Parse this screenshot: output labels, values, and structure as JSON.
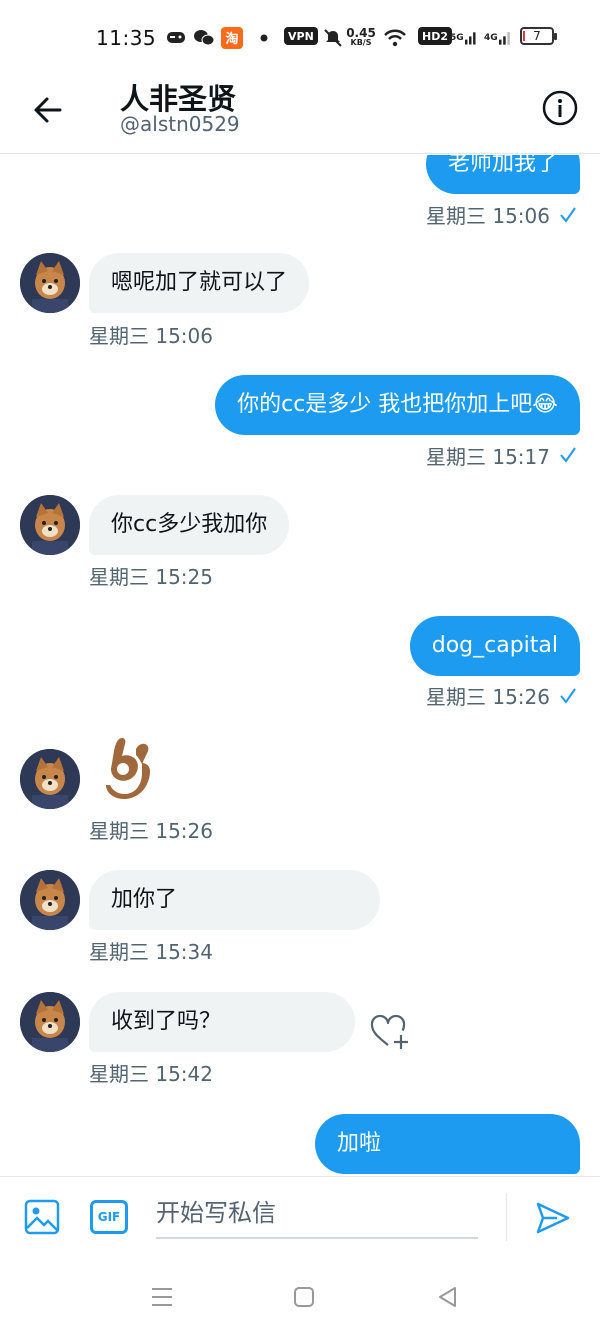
{
  "status_bar": {
    "time": "11:35",
    "speed_value": "0.45",
    "speed_unit": "KB/S",
    "vpn": "VPN",
    "hd": "HD2",
    "sig1": "5G",
    "sig2": "4G",
    "battery": "7"
  },
  "header": {
    "title": "人非圣贤",
    "handle": "@alstn0529"
  },
  "messages": [
    {
      "dir": "out",
      "text": "老师加我了",
      "time": "星期三 15:06"
    },
    {
      "dir": "in",
      "text": "嗯呢加了就可以了",
      "time": "星期三 15:06"
    },
    {
      "dir": "out",
      "text": "你的cc是多少 我也把你加上吧😂",
      "time": "星期三 15:17"
    },
    {
      "dir": "in",
      "text": "你cc多少我加你",
      "time": "星期三 15:25"
    },
    {
      "dir": "out",
      "text": "dog_capital",
      "time": "星期三 15:26"
    },
    {
      "dir": "in",
      "text": "👌🏽",
      "time": "星期三 15:26"
    },
    {
      "dir": "in",
      "text": "加你了",
      "time": "星期三 15:34"
    },
    {
      "dir": "in",
      "text": "收到了吗？",
      "time": "星期三 15:42"
    },
    {
      "dir": "out",
      "text": "加啦"
    }
  ],
  "composer": {
    "placeholder": "开始写私信",
    "gif_label": "GIF"
  },
  "icons": {
    "back": "arrow-left-icon",
    "info": "info-icon",
    "image": "image-icon",
    "gif": "gif-icon",
    "send": "send-icon",
    "like": "heart-plus-icon",
    "read": "check-icon"
  },
  "colors": {
    "accent": "#1d9bf0",
    "incoming_bubble": "#eff3f4",
    "secondary_text": "#536471"
  }
}
